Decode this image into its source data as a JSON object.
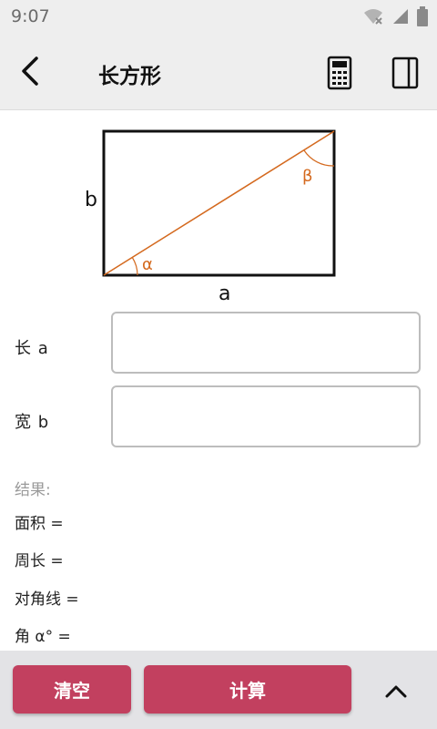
{
  "status": {
    "time": "9:07"
  },
  "header": {
    "title": "长方形"
  },
  "diagram": {
    "side_a": "a",
    "side_b": "b",
    "angle_alpha": "α",
    "angle_beta": "β"
  },
  "inputs": [
    {
      "label": "长 a",
      "value": ""
    },
    {
      "label": "宽 b",
      "value": ""
    }
  ],
  "results": {
    "header": "结果:",
    "items": [
      {
        "label": "面积 ="
      },
      {
        "label": "周长 ="
      },
      {
        "label": "对角线 ="
      },
      {
        "label": "角  α° ="
      }
    ]
  },
  "actions": {
    "clear_label": "清空",
    "calculate_label": "计算"
  },
  "colors": {
    "accent": "#c2405f",
    "diagram_angle": "#d4691e"
  }
}
